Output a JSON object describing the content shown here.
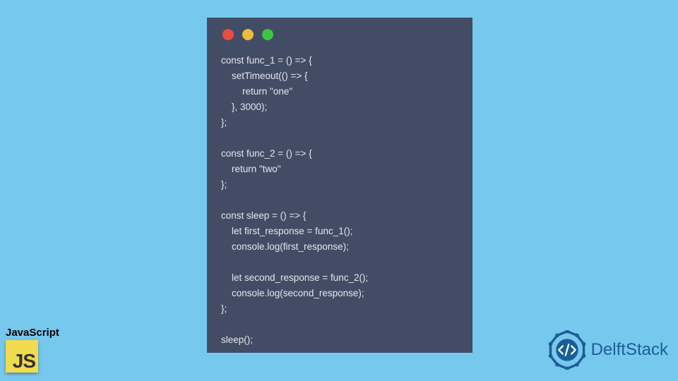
{
  "code_window": {
    "lines": [
      "const func_1 = () => {",
      "    setTimeout(() => {",
      "        return \"one\"",
      "    }, 3000);",
      "};",
      "",
      "const func_2 = () => {",
      "    return \"two\"",
      "};",
      "",
      "const sleep = () => {",
      "    let first_response = func_1();",
      "    console.log(first_response);",
      "",
      "    let second_response = func_2();",
      "    console.log(second_response);",
      "};",
      "",
      "sleep();"
    ]
  },
  "js_badge": {
    "label": "JavaScript",
    "logo_text": "JS"
  },
  "delftstack": {
    "name": "DelftStack"
  },
  "colors": {
    "background": "#77c8ed",
    "window_bg": "#434c65",
    "code_text": "#e6e8ec",
    "red": "#e94f3e",
    "yellow": "#e9bb3e",
    "green": "#3ec445",
    "js_yellow": "#f0db4f",
    "ds_blue": "#1b5d96"
  }
}
